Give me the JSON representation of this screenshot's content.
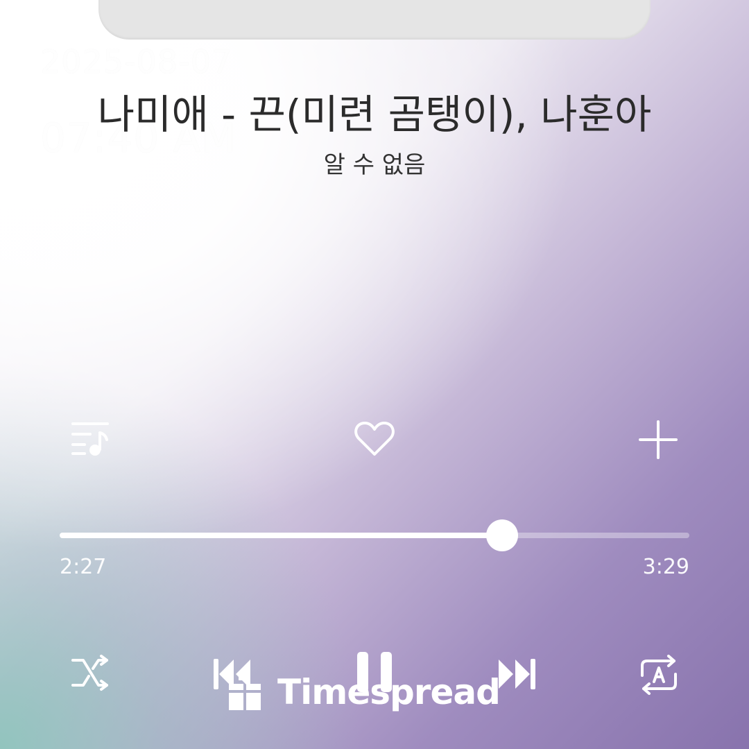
{
  "overlay": {
    "date": "2025-08-07",
    "time": "07:40 AM"
  },
  "track": {
    "title": "나미애 - 끈(미련 곰탱이), 나훈아",
    "artist": "알 수 없음"
  },
  "actions": {
    "queue_icon": "music-queue-icon",
    "favorite_icon": "heart-outline-icon",
    "add_icon": "plus-icon"
  },
  "playback": {
    "elapsed": "2:27",
    "total": "3:29",
    "progress_fraction": 0.703,
    "state": "playing"
  },
  "controls": {
    "shuffle_icon": "shuffle-icon",
    "previous_icon": "skip-previous-icon",
    "play_pause_icon": "pause-icon",
    "next_icon": "skip-next-icon",
    "repeat_icon": "repeat-a-icon"
  },
  "watermark": {
    "text": "Timespread"
  },
  "colors": {
    "accent": "#ffffff",
    "title_text": "#2b2b2b",
    "gradient_purple": "#8873ad",
    "gradient_teal": "#8ec4bc"
  }
}
